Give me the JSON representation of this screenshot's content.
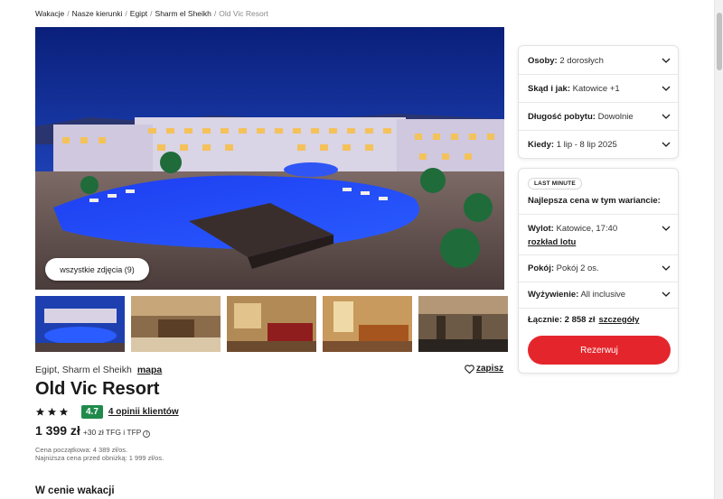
{
  "breadcrumb": [
    {
      "label": "Wakacje",
      "current": false
    },
    {
      "label": "Nasze kierunki",
      "current": false
    },
    {
      "label": "Egipt",
      "current": false
    },
    {
      "label": "Sharm el Sheikh",
      "current": false
    },
    {
      "label": "Old Vic Resort",
      "current": true
    }
  ],
  "gallery": {
    "all_photos_label": "wszystkie zdjęcia (9)"
  },
  "hotel": {
    "location": "Egipt, Sharm el Sheikh",
    "map_label": "mapa",
    "save_label": "zapisz",
    "name": "Old Vic Resort",
    "stars": 3,
    "score": "4.7",
    "reviews_label": "4 opinii klientów",
    "price": "1 399 zł",
    "price_extra": "+30 zł TFG i TFP",
    "initial_price_note": "Cena początkowa: 4 389 zł/os.",
    "lowest_price_note": "Najniższa cena przed obniżką: 1 999 zł/os.",
    "section_heading": "W cenie wakacji"
  },
  "search_card": {
    "rows": [
      {
        "label": "Osoby:",
        "value": "2 dorosłych"
      },
      {
        "label": "Skąd i jak:",
        "value": "Katowice +1"
      },
      {
        "label": "Długość pobytu:",
        "value": "Dowolnie"
      },
      {
        "label": "Kiedy:",
        "value": "1 lip - 8 lip 2025"
      }
    ]
  },
  "offer_card": {
    "badge": "LAST MINUTE",
    "best_price_label": "Najlepsza cena w tym wariancie:",
    "flight": {
      "label": "Wylot:",
      "value": "Katowice, 17:40",
      "link": "rozkład lotu"
    },
    "room": {
      "label": "Pokój:",
      "value": "Pokój 2 os."
    },
    "board": {
      "label": "Wyżywienie:",
      "value": "All inclusive"
    },
    "total": {
      "label": "Łącznie:",
      "value": "2 858 zł",
      "details_link": "szczegóły"
    },
    "book_label": "Rezerwuj"
  },
  "colors": {
    "accent_red": "#e4262c",
    "score_green": "#1f8a4c"
  }
}
